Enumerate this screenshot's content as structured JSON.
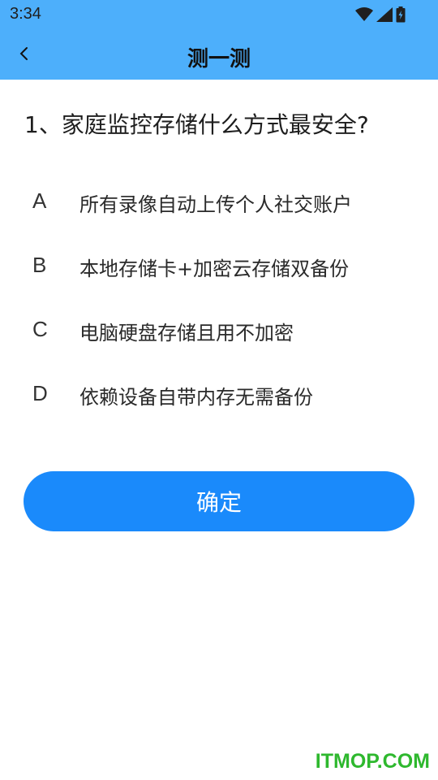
{
  "status_bar": {
    "time": "3:34",
    "icons": [
      "wifi-icon",
      "signal-icon",
      "battery-charging-icon"
    ]
  },
  "nav": {
    "back_icon": "chevron-left-icon",
    "title": "测一测"
  },
  "question": {
    "text": "1、家庭监控存储什么方式最安全?"
  },
  "options": [
    {
      "letter": "A",
      "text": "所有录像自动上传个人社交账户"
    },
    {
      "letter": "B",
      "text": "本地存储卡+加密云存储双备份"
    },
    {
      "letter": "C",
      "text": "电脑硬盘存储且用不加密"
    },
    {
      "letter": "D",
      "text": "依赖设备自带内存无需备份"
    }
  ],
  "confirm_button": {
    "label": "确定"
  },
  "watermark": {
    "text": "ITMOP.COM"
  },
  "colors": {
    "header_bg": "#4daffb",
    "button_bg": "#1a8afb",
    "watermark": "#2eb82e"
  }
}
